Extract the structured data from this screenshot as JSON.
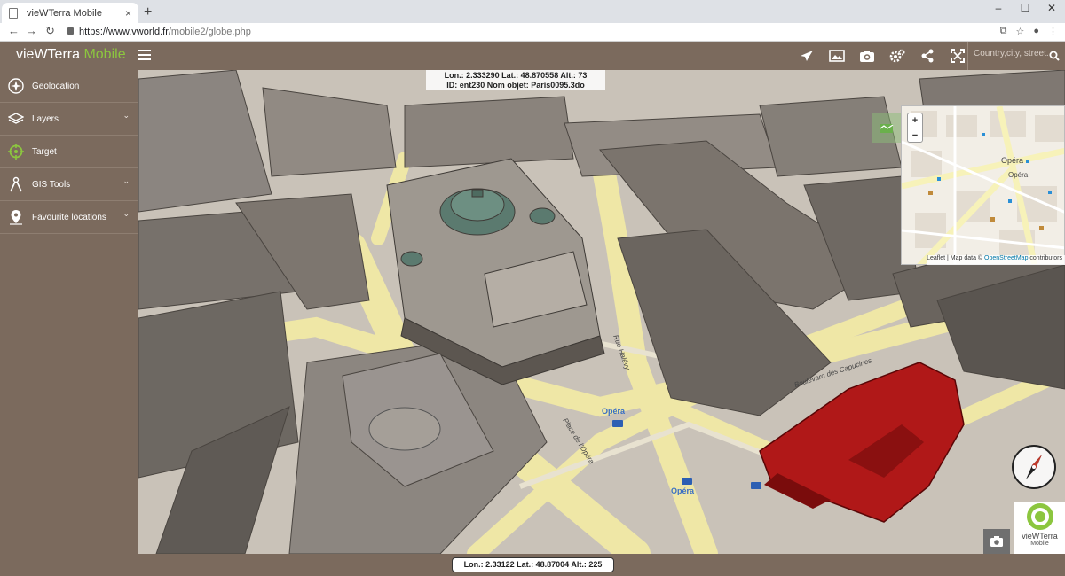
{
  "browser": {
    "tab_title": "vieWTerra Mobile",
    "tab_close": "×",
    "new_tab": "+",
    "url_domain": "https://www.vworld.fr",
    "url_path": "/mobile2/globe.php",
    "window_controls": [
      "–",
      "☐",
      "✕"
    ],
    "nav": {
      "back": "←",
      "forward": "→",
      "reload": "↻"
    }
  },
  "app": {
    "brand_main": "vieWTerra ",
    "brand_accent": "Mobile",
    "accent_color": "#8cc63f",
    "chrome_color": "#7b6a5d",
    "toolbar_icons": [
      "plane-icon",
      "image-icon",
      "camera-icon",
      "settings-icon",
      "share-icon",
      "fullscreen-icon"
    ],
    "search": {
      "placeholder": "Country,city, street..."
    }
  },
  "sidebar": {
    "items": [
      {
        "label": "Geolocation",
        "icon": "geolocation-icon",
        "expandable": false
      },
      {
        "label": "Layers",
        "icon": "layers-icon",
        "expandable": true
      },
      {
        "label": "Target",
        "icon": "target-icon",
        "expandable": false
      },
      {
        "label": "GIS Tools",
        "icon": "gis-tools-icon",
        "expandable": true
      },
      {
        "label": "Favourite locations",
        "icon": "location-pin-icon",
        "expandable": true
      }
    ],
    "chevron": "⌄"
  },
  "view": {
    "top_coords_line1": "Lon.: 2.333290  Lat.: 48.870558  Alt.: 73",
    "top_coords_line2": "ID: ent230  Nom objet: Paris0095.3do",
    "bottom_coords": "Lon.: 2.33122  Lat.: 48.87004  Alt.: 225",
    "minimap": {
      "zoom_in": "+",
      "zoom_out": "−",
      "attribution_prefix": "Leaflet | Map data © ",
      "attribution_link": "OpenStreetMap",
      "attribution_suffix": " contributors",
      "labels": [
        "Opéra",
        "Opéra"
      ]
    },
    "street_labels": [
      "Opéra",
      "Opéra",
      "Boulevard des Capucines",
      "Place de l'Opéra",
      "Rue Halévy"
    ],
    "logo_label": "Mobile",
    "logo_text": "vieWTerra"
  }
}
